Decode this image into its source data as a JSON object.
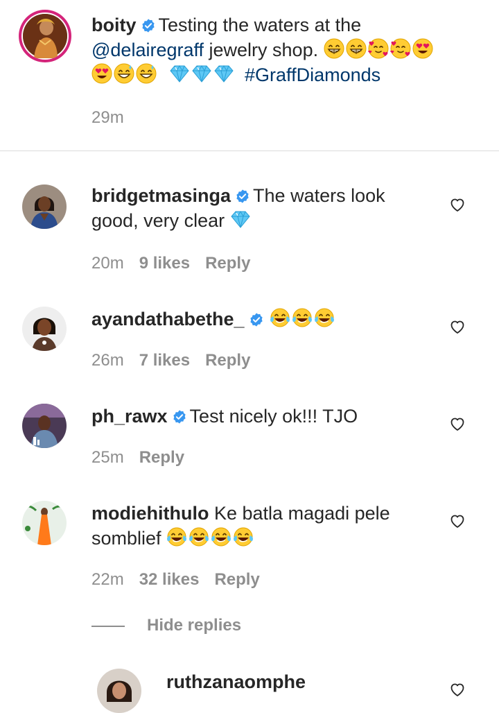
{
  "post": {
    "username": "boity",
    "text_1": "Testing the waters at the",
    "mention": "@delairegraff",
    "text_2": "jewelry shop.",
    "hashtag": "#GraffDiamonds",
    "time": "29m"
  },
  "comments": [
    {
      "username": "bridgetmasinga",
      "text_1": "The waters look",
      "text_2": "good, very clear",
      "time": "20m",
      "likes": "9 likes",
      "reply": "Reply"
    },
    {
      "username": "ayandathabethe_",
      "time": "26m",
      "likes": "7 likes",
      "reply": "Reply"
    },
    {
      "username": "ph_rawx",
      "text_1": "Test nicely ok!!! TJO",
      "time": "25m",
      "reply": "Reply"
    },
    {
      "username": "modiehithulo",
      "text_1": "Ke batla magadi pele",
      "text_2": "somblief",
      "time": "22m",
      "likes": "32 likes",
      "reply": "Reply"
    }
  ],
  "hide_replies": "Hide replies",
  "reply_preview": {
    "username": "ruthzanaomphe"
  },
  "colors": {
    "link": "#00376b",
    "verified": "#3897f0",
    "muted": "#8e8e8e"
  },
  "icons": [
    "verified-badge-icon",
    "heart-outline-icon",
    "grinning-emoji",
    "smiling-hearts-emoji",
    "heart-eyes-emoji",
    "sweat-smile-emoji",
    "gem-emoji",
    "tears-of-joy-emoji"
  ]
}
